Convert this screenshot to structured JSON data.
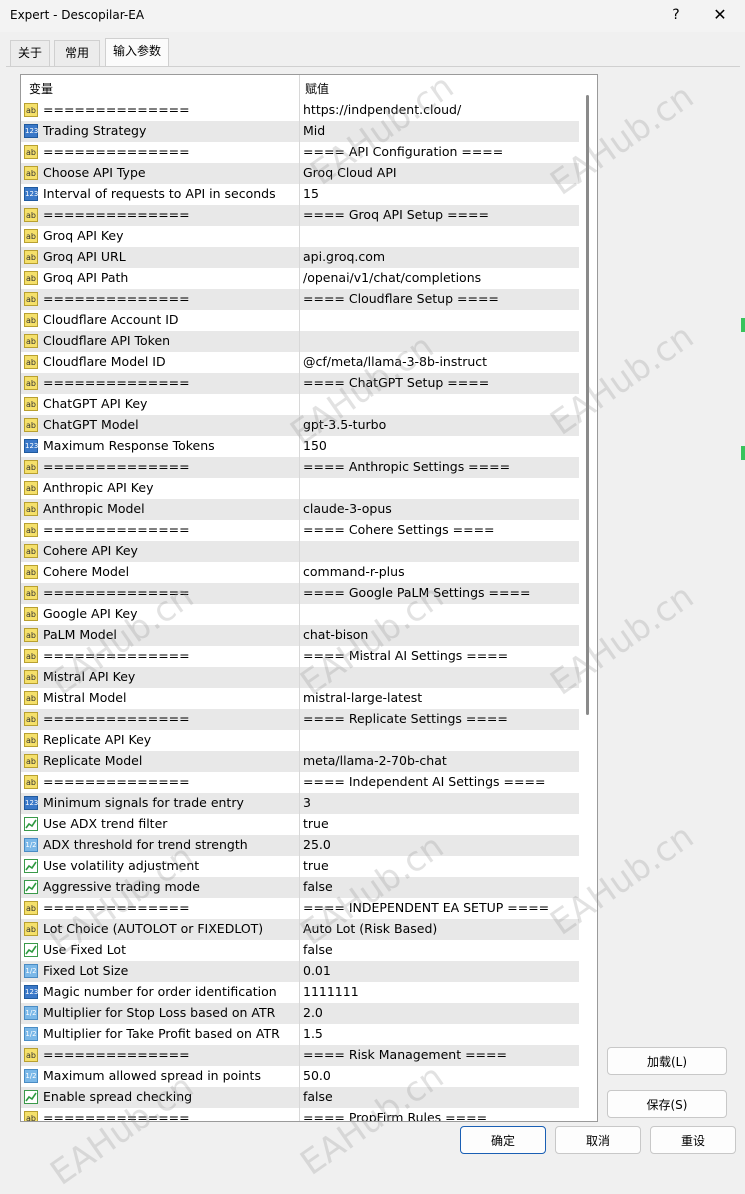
{
  "window": {
    "title": "Expert - Descopilar-EA",
    "help_glyph": "?",
    "close_glyph": "✕"
  },
  "tabs": [
    {
      "label": "关于"
    },
    {
      "label": "常用"
    },
    {
      "label": "输入参数"
    }
  ],
  "table": {
    "headers": {
      "variable": "变量",
      "value": "赋值"
    },
    "rows": [
      {
        "type": "ab",
        "name": "==============",
        "value": "https://indpendent.cloud/"
      },
      {
        "type": "int",
        "name": "Trading Strategy",
        "value": "Mid"
      },
      {
        "type": "ab",
        "name": "==============",
        "value": "==== API Configuration ===="
      },
      {
        "type": "ab",
        "name": "Choose API Type",
        "value": "Groq Cloud API"
      },
      {
        "type": "int",
        "name": "Interval of requests to API in seconds",
        "value": "15"
      },
      {
        "type": "ab",
        "name": "==============",
        "value": "==== Groq API Setup ===="
      },
      {
        "type": "ab",
        "name": "Groq API Key",
        "value": ""
      },
      {
        "type": "ab",
        "name": "Groq API URL",
        "value": "api.groq.com"
      },
      {
        "type": "ab",
        "name": "Groq API Path",
        "value": "/openai/v1/chat/completions"
      },
      {
        "type": "ab",
        "name": "==============",
        "value": "==== Cloudflare Setup ===="
      },
      {
        "type": "ab",
        "name": "Cloudflare Account ID",
        "value": ""
      },
      {
        "type": "ab",
        "name": "Cloudflare API Token",
        "value": ""
      },
      {
        "type": "ab",
        "name": "Cloudflare Model ID",
        "value": "@cf/meta/llama-3-8b-instruct"
      },
      {
        "type": "ab",
        "name": "==============",
        "value": "==== ChatGPT Setup ===="
      },
      {
        "type": "ab",
        "name": "ChatGPT API Key",
        "value": ""
      },
      {
        "type": "ab",
        "name": "ChatGPT Model",
        "value": "gpt-3.5-turbo"
      },
      {
        "type": "int",
        "name": "Maximum Response Tokens",
        "value": "150"
      },
      {
        "type": "ab",
        "name": "==============",
        "value": "==== Anthropic Settings ===="
      },
      {
        "type": "ab",
        "name": "Anthropic API Key",
        "value": ""
      },
      {
        "type": "ab",
        "name": "Anthropic Model",
        "value": "claude-3-opus"
      },
      {
        "type": "ab",
        "name": "==============",
        "value": "==== Cohere Settings ===="
      },
      {
        "type": "ab",
        "name": "Cohere API Key",
        "value": ""
      },
      {
        "type": "ab",
        "name": "Cohere Model",
        "value": "command-r-plus"
      },
      {
        "type": "ab",
        "name": "==============",
        "value": "==== Google PaLM Settings ===="
      },
      {
        "type": "ab",
        "name": "Google API Key",
        "value": ""
      },
      {
        "type": "ab",
        "name": "PaLM Model",
        "value": "chat-bison"
      },
      {
        "type": "ab",
        "name": "==============",
        "value": "==== Mistral AI Settings ===="
      },
      {
        "type": "ab",
        "name": "Mistral API Key",
        "value": ""
      },
      {
        "type": "ab",
        "name": "Mistral Model",
        "value": "mistral-large-latest"
      },
      {
        "type": "ab",
        "name": "==============",
        "value": "==== Replicate Settings ===="
      },
      {
        "type": "ab",
        "name": "Replicate API Key",
        "value": ""
      },
      {
        "type": "ab",
        "name": "Replicate Model",
        "value": "meta/llama-2-70b-chat"
      },
      {
        "type": "ab",
        "name": "==============",
        "value": "==== Independent AI Settings ===="
      },
      {
        "type": "int",
        "name": "Minimum signals for trade entry",
        "value": "3"
      },
      {
        "type": "bool",
        "name": "Use ADX trend filter",
        "value": "true"
      },
      {
        "type": "dbl",
        "name": "ADX threshold for trend strength",
        "value": "25.0"
      },
      {
        "type": "bool",
        "name": "Use volatility adjustment",
        "value": "true"
      },
      {
        "type": "bool",
        "name": "Aggressive trading mode",
        "value": "false"
      },
      {
        "type": "ab",
        "name": "==============",
        "value": "==== INDEPENDENT EA SETUP ===="
      },
      {
        "type": "ab",
        "name": "Lot Choice (AUTOLOT or FIXEDLOT)",
        "value": "Auto Lot (Risk Based)"
      },
      {
        "type": "bool",
        "name": "Use Fixed Lot",
        "value": "false"
      },
      {
        "type": "dbl",
        "name": "Fixed Lot Size",
        "value": "0.01"
      },
      {
        "type": "int",
        "name": "Magic number for order identification",
        "value": "1111111"
      },
      {
        "type": "dbl",
        "name": "Multiplier for Stop Loss based on ATR",
        "value": "2.0"
      },
      {
        "type": "dbl",
        "name": "Multiplier for Take Profit based on ATR",
        "value": "1.5"
      },
      {
        "type": "ab",
        "name": "==============",
        "value": "==== Risk Management ===="
      },
      {
        "type": "dbl",
        "name": "Maximum allowed spread in points",
        "value": "50.0"
      },
      {
        "type": "bool",
        "name": "Enable spread checking",
        "value": "false"
      },
      {
        "type": "ab",
        "name": "==============",
        "value": "==== PropFirm Rules ===="
      }
    ]
  },
  "buttons": {
    "load": "加载(L)",
    "save": "保存(S)",
    "ok": "确定",
    "cancel": "取消",
    "reset": "重设"
  },
  "watermark": "EAHub.cn",
  "icons": {
    "ab": "ab",
    "int": "123",
    "dbl": "1/2"
  }
}
